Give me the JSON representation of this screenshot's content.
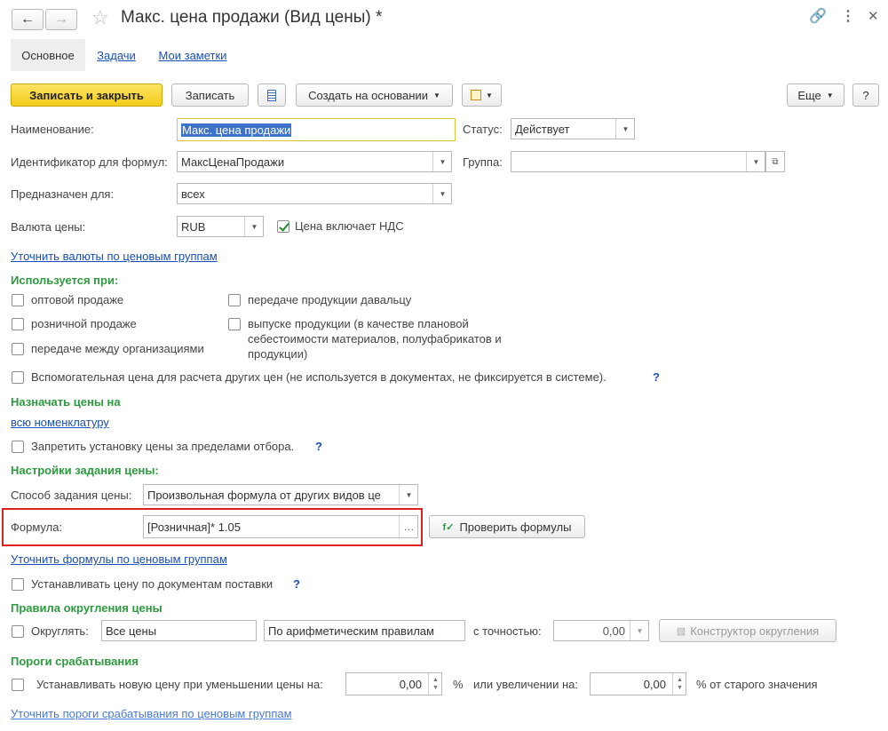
{
  "window": {
    "title": "Макс. цена продажи (Вид цены) *"
  },
  "tabs": [
    "Основное",
    "Задачи",
    "Мои заметки"
  ],
  "toolbar": {
    "save_close": "Записать и закрыть",
    "save": "Записать",
    "create_based": "Создать на основании",
    "more": "Еще",
    "help": "?"
  },
  "form": {
    "name_label": "Наименование:",
    "name_value": "Макс. цена продажи",
    "status_label": "Статус:",
    "status_value": "Действует",
    "formula_id_label": "Идентификатор для формул:",
    "formula_id_value": "МаксЦенаПродажи",
    "group_label": "Группа:",
    "group_value": "",
    "intended_label": "Предназначен для:",
    "intended_value": "всех",
    "currency_label": "Валюта цены:",
    "currency_value": "RUB",
    "vat_label": "Цена включает НДС",
    "currency_link": "Уточнить валюты по ценовым группам"
  },
  "used_in": {
    "header": "Используется при:",
    "wholesale": "оптовой продаже",
    "retail": "розничной продаже",
    "between_orgs": "передаче между организациями",
    "to_customer": "передаче продукции давальцу",
    "production_line1": "выпуске продукции (в качестве плановой",
    "production_line2": "себестоимости материалов, полуфабрикатов и",
    "production_line3": "продукции)",
    "auxiliary": "Вспомогательная цена для расчета других цен (не используется в документах, не фиксируется в системе)."
  },
  "assign": {
    "header": "Назначать цены на",
    "link": "всю номенклатуру",
    "forbid": "Запретить установку цены за пределами отбора."
  },
  "price_settings": {
    "header": "Настройки задания цены:",
    "method_label": "Способ задания цены:",
    "method_value": "Произвольная формула от других видов це",
    "formula_label": "Формула:",
    "formula_value": "[Розничная]* 1.05",
    "check_button": "Проверить формулы",
    "formula_link": "Уточнить формулы по ценовым группам",
    "by_supply": "Устанавливать цену по документам поставки"
  },
  "rounding": {
    "header": "Правила округления цены",
    "round_label": "Округлять:",
    "prices_value": "Все цены",
    "rule_value": "По арифметическим правилам",
    "precision_label": "с точностью:",
    "precision_value": "0,00",
    "constructor_button": "Конструктор округления"
  },
  "thresholds": {
    "header": "Пороги срабатывания",
    "decrease_label": "Устанавливать новую цену при уменьшении цены на:",
    "decrease_value": "0,00",
    "percent": "%",
    "increase_label": "или увеличении на:",
    "increase_value": "0,00",
    "from_old": "% от старого значения",
    "link": "Уточнить пороги срабатывания по ценовым группам"
  },
  "colors": {
    "accent_green": "#2d9a3f",
    "link_blue": "#1a4fb5",
    "highlight_red": "#e02020",
    "primary_button": "#f4cc1a"
  }
}
